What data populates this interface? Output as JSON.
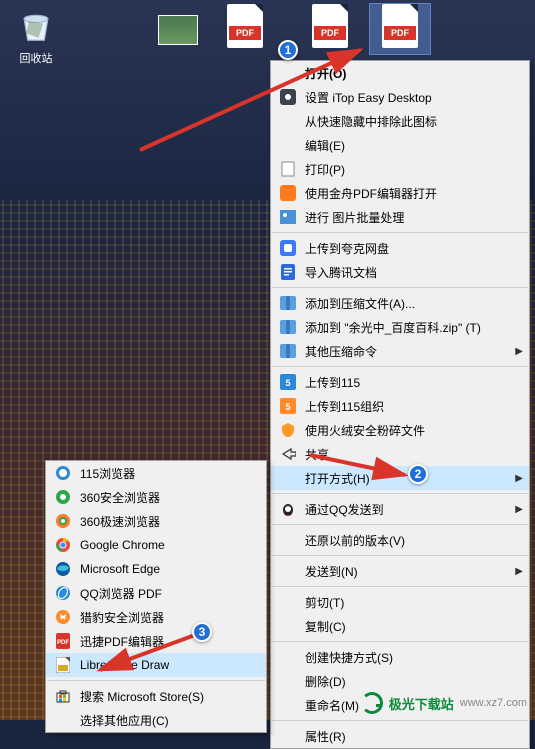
{
  "desktop": {
    "recycle_bin_label": "回收站",
    "pdf_badge": "PDF"
  },
  "menu_main": {
    "open": "打开(O)",
    "itop": "设置 iTop Easy Desktop",
    "exclude_hide": "从快速隐藏中排除此图标",
    "edit": "编辑(E)",
    "print": "打印(P)",
    "jinzhou_pdf": "使用金舟PDF编辑器打开",
    "batch_image": "进行 图片批量处理",
    "kuake": "上传到夸克网盘",
    "tencent_docs": "导入腾讯文档",
    "add_archive": "添加到压缩文件(A)...",
    "add_archive_named": "添加到 \"余光中_百度百科.zip\" (T)",
    "other_compress": "其他压缩命令",
    "upload_115": "上传到115",
    "upload_115_org": "上传到115组织",
    "huorong": "使用火绒安全粉碎文件",
    "share": "共享",
    "open_with": "打开方式(H)",
    "qq_send": "通过QQ发送到",
    "restore_prev": "还原以前的版本(V)",
    "send_to": "发送到(N)",
    "cut": "剪切(T)",
    "copy": "复制(C)",
    "create_shortcut": "创建快捷方式(S)",
    "delete": "删除(D)",
    "rename": "重命名(M)",
    "properties": "属性(R)"
  },
  "menu_sub": {
    "browser_115": "115浏览器",
    "browser_360safe": "360安全浏览器",
    "browser_360speed": "360极速浏览器",
    "chrome": "Google Chrome",
    "edge": "Microsoft Edge",
    "qq_pdf": "QQ浏览器 PDF",
    "liebao": "猎豹安全浏览器",
    "xunjie_pdf": "迅捷PDF编辑器",
    "libreoffice_draw": "LibreOffice Draw",
    "ms_store": "搜索 Microsoft Store(S)",
    "choose_other": "选择其他应用(C)"
  },
  "callouts": {
    "c1": "1",
    "c2": "2",
    "c3": "3"
  },
  "watermark": {
    "name": "极光下载站",
    "domain": "www.xz7.com"
  },
  "colors": {
    "highlight": "#cce8ff",
    "pdf_red": "#d9342a",
    "arrow_red": "#d9342a",
    "callout_blue": "#1e6fd9"
  }
}
